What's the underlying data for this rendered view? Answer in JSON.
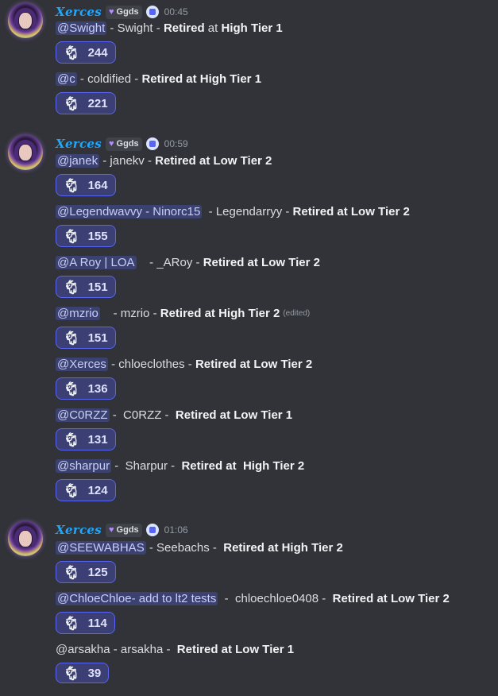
{
  "groups": [
    {
      "author": "Xerces",
      "tag": "Ggds",
      "time": "00:45",
      "messages": [
        {
          "mention": "@Swight",
          "text": " - Swight - ",
          "bold": "Retired",
          "text2": " at ",
          "bold2": "High Tier 1",
          "reaction": "244"
        },
        {
          "mention": "@c",
          "text": " - coldified - ",
          "bold": "Retired at High Tier 1",
          "reaction": "221"
        }
      ]
    },
    {
      "author": "Xerces",
      "tag": "Ggds",
      "time": "00:59",
      "messages": [
        {
          "mention": "@janek",
          "text": " - janekv - ",
          "bold": "Retired at Low Tier 2",
          "reaction": "164"
        },
        {
          "mention": "@Legendwavvy - Ninorc15",
          "text": "  - Legendarryy - ",
          "bold": "Retired at Low Tier 2",
          "reaction": "155"
        },
        {
          "mention": "@A Roy | LOA",
          "text": "    - _ARoy - ",
          "bold": "Retired at Low Tier 2",
          "reaction": "151"
        },
        {
          "mention": "@mzrio",
          "text": "    - mzrio - ",
          "bold": "Retired at High Tier 2",
          "edited": "(edited)",
          "reaction": "151"
        },
        {
          "mention": "@Xerces",
          "text": " - chloeclothes - ",
          "bold": "Retired at Low Tier 2",
          "reaction": "136"
        },
        {
          "mention": "@C0RZZ",
          "text": " -  C0RZZ -  ",
          "bold": "Retired at Low Tier 1",
          "reaction": "131"
        },
        {
          "mention": "@sharpur",
          "text": " -  Sharpur -  ",
          "bold": "Retired at  High Tier 2",
          "reaction": "124"
        }
      ]
    },
    {
      "author": "Xerces",
      "tag": "Ggds",
      "time": "01:06",
      "messages": [
        {
          "mention": "@SEEWABHAS",
          "text": " - Seebachs -  ",
          "bold": "Retired at High Tier 2",
          "reaction": "125"
        },
        {
          "mention": "@ChloeChloe- add to lt2 tests",
          "text": "  -  chloechloe0408 -  ",
          "bold": "Retired at Low Tier 2",
          "reaction": "114"
        },
        {
          "plain": "@arsakha - arsakha -  ",
          "bold": "Retired at Low Tier 1",
          "reaction": "39"
        }
      ]
    }
  ],
  "reaction_icon": "goat-emoji",
  "colors": {
    "background": "#313338",
    "username": "#1ea7ff",
    "mention_bg": "#3c4270",
    "reaction_bg": "#3b3f73",
    "reaction_border": "#5865f2"
  }
}
